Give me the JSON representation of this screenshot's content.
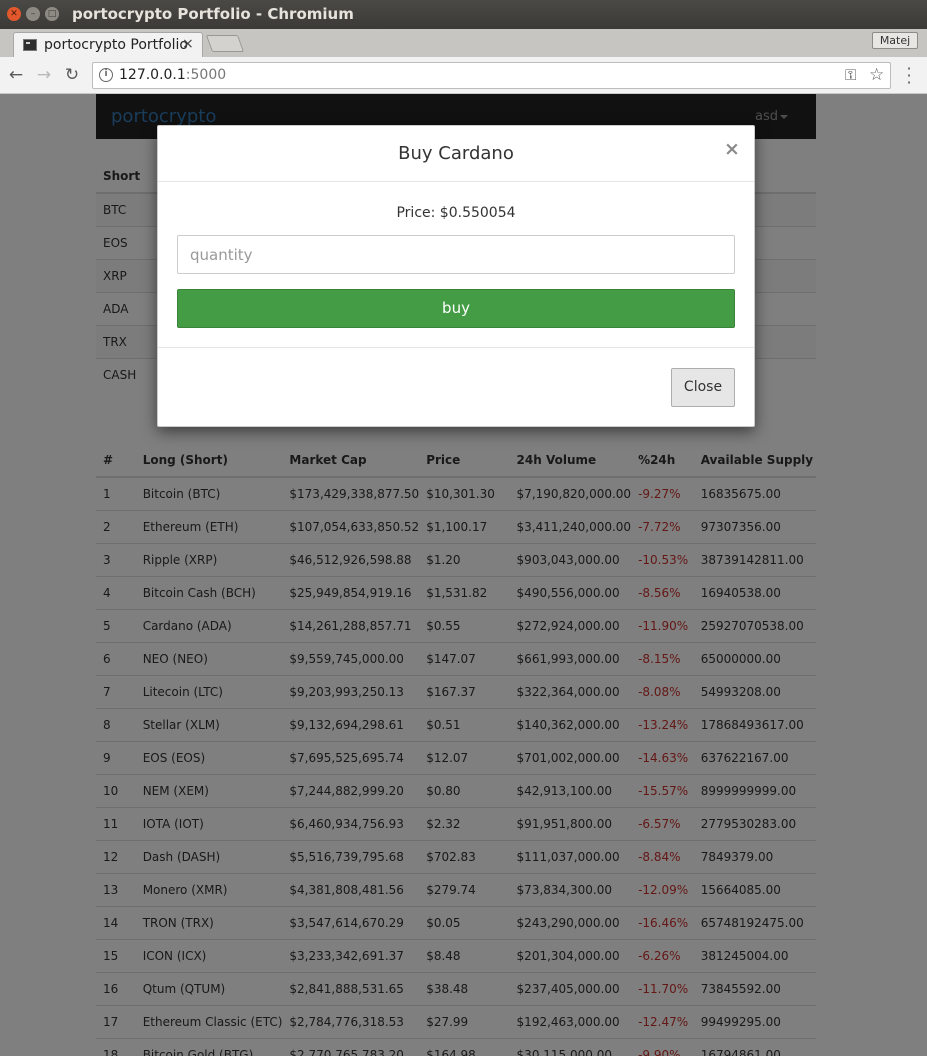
{
  "window": {
    "title": "portocrypto Portfolio - Chromium",
    "tab_title": "portocrypto Portfolio",
    "tab_close": "×",
    "profile": "Matej"
  },
  "address_bar": {
    "host": "127.0.0.1",
    "port": ":5000"
  },
  "navbar": {
    "brand": "portocrypto",
    "user": "asd"
  },
  "holdings": {
    "header": "Short",
    "rows": [
      "BTC",
      "EOS",
      "XRP",
      "ADA",
      "TRX",
      "CASH"
    ]
  },
  "market": {
    "columns": [
      "#",
      "Long (Short)",
      "Market Cap",
      "Price",
      "24h Volume",
      "%24h",
      "Available Supply"
    ],
    "rows": [
      [
        "1",
        "Bitcoin (BTC)",
        "$173,429,338,877.50",
        "$10,301.30",
        "$7,190,820,000.00",
        "-9.27%",
        "16835675.00"
      ],
      [
        "2",
        "Ethereum (ETH)",
        "$107,054,633,850.52",
        "$1,100.17",
        "$3,411,240,000.00",
        "-7.72%",
        "97307356.00"
      ],
      [
        "3",
        "Ripple (XRP)",
        "$46,512,926,598.88",
        "$1.20",
        "$903,043,000.00",
        "-10.53%",
        "38739142811.00"
      ],
      [
        "4",
        "Bitcoin Cash (BCH)",
        "$25,949,854,919.16",
        "$1,531.82",
        "$490,556,000.00",
        "-8.56%",
        "16940538.00"
      ],
      [
        "5",
        "Cardano (ADA)",
        "$14,261,288,857.71",
        "$0.55",
        "$272,924,000.00",
        "-11.90%",
        "25927070538.00"
      ],
      [
        "6",
        "NEO (NEO)",
        "$9,559,745,000.00",
        "$147.07",
        "$661,993,000.00",
        "-8.15%",
        "65000000.00"
      ],
      [
        "7",
        "Litecoin (LTC)",
        "$9,203,993,250.13",
        "$167.37",
        "$322,364,000.00",
        "-8.08%",
        "54993208.00"
      ],
      [
        "8",
        "Stellar (XLM)",
        "$9,132,694,298.61",
        "$0.51",
        "$140,362,000.00",
        "-13.24%",
        "17868493617.00"
      ],
      [
        "9",
        "EOS (EOS)",
        "$7,695,525,695.74",
        "$12.07",
        "$701,002,000.00",
        "-14.63%",
        "637622167.00"
      ],
      [
        "10",
        "NEM (XEM)",
        "$7,244,882,999.20",
        "$0.80",
        "$42,913,100.00",
        "-15.57%",
        "8999999999.00"
      ],
      [
        "11",
        "IOTA (IOT)",
        "$6,460,934,756.93",
        "$2.32",
        "$91,951,800.00",
        "-6.57%",
        "2779530283.00"
      ],
      [
        "12",
        "Dash (DASH)",
        "$5,516,739,795.68",
        "$702.83",
        "$111,037,000.00",
        "-8.84%",
        "7849379.00"
      ],
      [
        "13",
        "Monero (XMR)",
        "$4,381,808,481.56",
        "$279.74",
        "$73,834,300.00",
        "-12.09%",
        "15664085.00"
      ],
      [
        "14",
        "TRON (TRX)",
        "$3,547,614,670.29",
        "$0.05",
        "$243,290,000.00",
        "-16.46%",
        "65748192475.00"
      ],
      [
        "15",
        "ICON (ICX)",
        "$3,233,342,691.37",
        "$8.48",
        "$201,304,000.00",
        "-6.26%",
        "381245004.00"
      ],
      [
        "16",
        "Qtum (QTUM)",
        "$2,841,888,531.65",
        "$38.48",
        "$237,405,000.00",
        "-11.70%",
        "73845592.00"
      ],
      [
        "17",
        "Ethereum Classic (ETC)",
        "$2,784,776,318.53",
        "$27.99",
        "$192,463,000.00",
        "-12.47%",
        "99499295.00"
      ],
      [
        "18",
        "Bitcoin Gold (BTG)",
        "$2,770,765,783.20",
        "$164.98",
        "$30,115,000.00",
        "-9.90%",
        "16794861.00"
      ]
    ]
  },
  "modal": {
    "title": "Buy Cardano",
    "close_x": "×",
    "price_label": "Price: $0.550054",
    "quantity_placeholder": "quantity",
    "buy_label": "buy",
    "close_label": "Close"
  }
}
